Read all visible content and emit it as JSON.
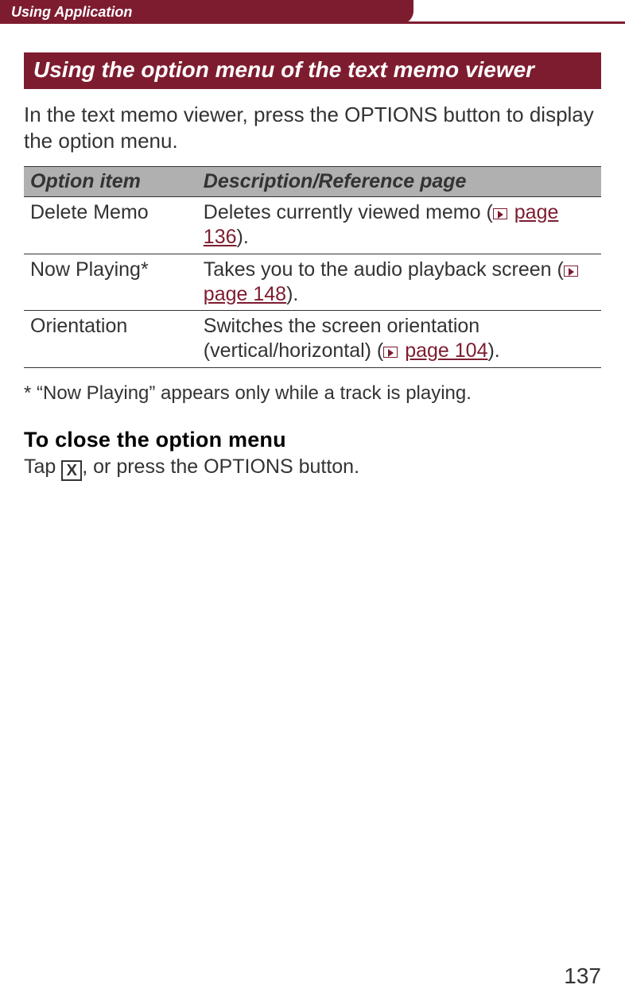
{
  "header": {
    "tab_label": "Using Application"
  },
  "section": {
    "heading": "Using the option menu of the text memo viewer"
  },
  "intro": "In the text memo viewer, press the OPTIONS button to display the option menu.",
  "table": {
    "headers": {
      "option": "Option item",
      "desc": "Description/Reference page"
    },
    "rows": [
      {
        "option": "Delete Memo",
        "desc_before": "Deletes currently viewed memo (",
        "ref": "page 136",
        "desc_after": ")."
      },
      {
        "option": "Now Playing*",
        "desc_before": "Takes you to the audio playback screen (",
        "ref": "page 148",
        "desc_after": ")."
      },
      {
        "option": "Orientation",
        "desc_before": "Switches the screen orientation (vertical/horizontal) (",
        "ref": "page 104",
        "desc_after": ")."
      }
    ]
  },
  "footnote": "* “Now Playing” appears only while a track is playing.",
  "close_section": {
    "heading": "To close the option menu",
    "before": "Tap ",
    "x": "X",
    "after": ", or press the OPTIONS button."
  },
  "page_number": "137"
}
